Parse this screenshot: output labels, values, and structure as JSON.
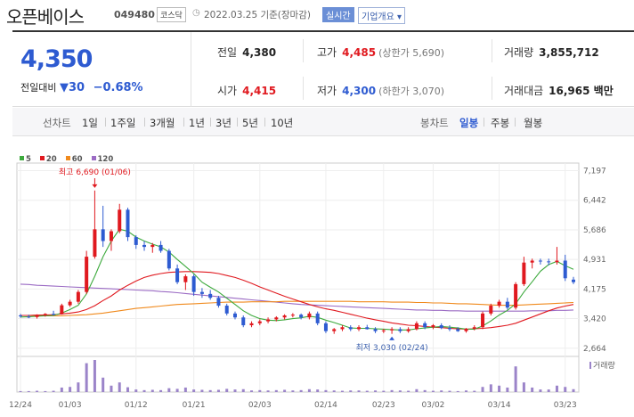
{
  "header": {
    "name": "오픈베이스",
    "code": "049480",
    "market": "코스닥",
    "date_text": "2022.03.25  기준(장마감)",
    "realtime_button": "실시간",
    "company_button": "기업개요 ▾"
  },
  "summary": {
    "price": "4,350",
    "change_label": "전일대비",
    "change_value": "▼30",
    "change_rate": "−0.68%",
    "prev_close_label": "전일",
    "prev_close": "4,380",
    "high_label": "고가",
    "high": "4,485",
    "upper_limit": "(상한가 5,690)",
    "volume_label": "거래량",
    "volume": "3,855,712",
    "open_label": "시가",
    "open": "4,415",
    "low_label": "저가",
    "low": "4,300",
    "lower_limit": "(하한가 3,070)",
    "amount_label": "거래대금",
    "amount": "16,965 백만"
  },
  "tabs": {
    "line_label": "선차트",
    "line_periods": [
      "1일",
      "1주일",
      "3개월",
      "1년",
      "3년",
      "5년",
      "10년"
    ],
    "candle_label": "봉차트",
    "candle_periods": [
      "일봉",
      "주봉",
      "월봉"
    ],
    "selected": "일봉"
  },
  "chart_data": {
    "type": "candlestick",
    "up_color": "#e0191f",
    "down_color": "#2e5bd1",
    "ylim": [
      2500,
      7300
    ],
    "y_ticks": [
      7197,
      6442,
      5686,
      4931,
      4175,
      3420,
      2664
    ],
    "y_tick_labels": [
      "7,197",
      "6,442",
      "5,686",
      "4,931",
      "4,175",
      "3,420",
      "2,664"
    ],
    "x_labels": [
      "12/24",
      "01/03",
      "01/12",
      "01/21",
      "02/03",
      "02/14",
      "02/23",
      "03/02",
      "03/14",
      "03/23"
    ],
    "x_label_index": [
      0,
      6,
      14,
      21,
      29,
      37,
      44,
      50,
      58,
      66
    ],
    "legend": [
      {
        "name": "5",
        "color": "#3daa3d"
      },
      {
        "name": "20",
        "color": "#e0191f"
      },
      {
        "name": "60",
        "color": "#f08a1d"
      },
      {
        "name": "120",
        "color": "#9b6bc4"
      }
    ],
    "volume_label": "거래량",
    "max_annotation": {
      "text": "최고 6,690 (01/06)",
      "index": 9,
      "value": 6690
    },
    "min_annotation": {
      "text": "최저 3,030 (02/24)",
      "index": 45,
      "value": 3030
    },
    "candles": [
      [
        3500,
        3540,
        3440,
        3480
      ],
      [
        3470,
        3520,
        3430,
        3450
      ],
      [
        3460,
        3530,
        3420,
        3500
      ],
      [
        3500,
        3560,
        3470,
        3540
      ],
      [
        3540,
        3620,
        3500,
        3530
      ],
      [
        3530,
        3800,
        3520,
        3760
      ],
      [
        3760,
        3900,
        3720,
        3850
      ],
      [
        3850,
        4150,
        3800,
        4100
      ],
      [
        4100,
        5150,
        4050,
        5000
      ],
      [
        5000,
        6690,
        4950,
        5700
      ],
      [
        5700,
        6300,
        5250,
        5400
      ],
      [
        5400,
        5700,
        5150,
        5650
      ],
      [
        5650,
        6350,
        5600,
        6200
      ],
      [
        6200,
        6250,
        5400,
        5500
      ],
      [
        5500,
        5550,
        5200,
        5300
      ],
      [
        5300,
        5400,
        5150,
        5250
      ],
      [
        5250,
        5350,
        5100,
        5300
      ],
      [
        5300,
        5400,
        5100,
        5150
      ],
      [
        5150,
        5200,
        4650,
        4700
      ],
      [
        4700,
        4800,
        4300,
        4350
      ],
      [
        4350,
        4550,
        4150,
        4500
      ],
      [
        4500,
        4550,
        4000,
        4100
      ],
      [
        4100,
        4200,
        3950,
        4050
      ],
      [
        4050,
        4150,
        3900,
        3950
      ],
      [
        3950,
        4000,
        3700,
        3750
      ],
      [
        3750,
        3800,
        3500,
        3550
      ],
      [
        3550,
        3600,
        3400,
        3450
      ],
      [
        3450,
        3500,
        3200,
        3250
      ],
      [
        3250,
        3350,
        3200,
        3300
      ],
      [
        3300,
        3400,
        3250,
        3350
      ],
      [
        3350,
        3450,
        3300,
        3400
      ],
      [
        3400,
        3480,
        3350,
        3450
      ],
      [
        3450,
        3530,
        3400,
        3500
      ],
      [
        3500,
        3560,
        3450,
        3520
      ],
      [
        3520,
        3550,
        3400,
        3450
      ],
      [
        3450,
        3600,
        3400,
        3550
      ],
      [
        3550,
        3600,
        3250,
        3300
      ],
      [
        3300,
        3350,
        3050,
        3100
      ],
      [
        3100,
        3180,
        3030,
        3150
      ],
      [
        3150,
        3250,
        3100,
        3200
      ],
      [
        3200,
        3250,
        3100,
        3150
      ],
      [
        3150,
        3250,
        3100,
        3200
      ],
      [
        3200,
        3260,
        3140,
        3150
      ],
      [
        3150,
        3200,
        3050,
        3100
      ],
      [
        3100,
        3160,
        3050,
        3120
      ],
      [
        3120,
        3200,
        3030,
        3150
      ],
      [
        3150,
        3200,
        3050,
        3100
      ],
      [
        3100,
        3200,
        3060,
        3150
      ],
      [
        3150,
        3350,
        3120,
        3300
      ],
      [
        3300,
        3350,
        3150,
        3200
      ],
      [
        3200,
        3280,
        3150,
        3250
      ],
      [
        3250,
        3300,
        3150,
        3180
      ],
      [
        3180,
        3250,
        3100,
        3150
      ],
      [
        3150,
        3200,
        3080,
        3100
      ],
      [
        3100,
        3180,
        3060,
        3160
      ],
      [
        3160,
        3250,
        3120,
        3200
      ],
      [
        3200,
        3600,
        3150,
        3550
      ],
      [
        3550,
        3800,
        3500,
        3750
      ],
      [
        3750,
        3900,
        3700,
        3850
      ],
      [
        3850,
        3950,
        3650,
        3700
      ],
      [
        3700,
        4350,
        3650,
        4300
      ],
      [
        4300,
        5000,
        4250,
        4850
      ],
      [
        4850,
        4950,
        4700,
        4900
      ],
      [
        4900,
        4950,
        4800,
        4880
      ],
      [
        4880,
        4950,
        4780,
        4860
      ],
      [
        4860,
        5250,
        4800,
        4900
      ],
      [
        4900,
        5050,
        4380,
        4450
      ],
      [
        4415,
        4485,
        4300,
        4350
      ]
    ],
    "volumes": [
      3,
      3,
      4,
      3,
      4,
      14,
      16,
      30,
      90,
      100,
      45,
      20,
      30,
      15,
      8,
      6,
      7,
      6,
      12,
      10,
      14,
      8,
      7,
      6,
      7,
      10,
      8,
      9,
      5,
      6,
      5,
      6,
      7,
      5,
      6,
      9,
      8,
      6,
      5,
      4,
      5,
      5,
      4,
      5,
      4,
      6,
      5,
      4,
      9,
      6,
      4,
      5,
      4,
      3,
      5,
      4,
      16,
      24,
      20,
      14,
      80,
      30,
      14,
      8,
      8,
      20,
      16,
      9
    ],
    "ma5": [
      3460,
      3470,
      3480,
      3490,
      3500,
      3560,
      3650,
      3760,
      4050,
      4500,
      5000,
      5400,
      5700,
      5650,
      5500,
      5400,
      5320,
      5250,
      5120,
      4930,
      4750,
      4570,
      4350,
      4220,
      4100,
      3940,
      3780,
      3620,
      3500,
      3420,
      3380,
      3370,
      3390,
      3420,
      3440,
      3480,
      3450,
      3380,
      3320,
      3250,
      3180,
      3170,
      3170,
      3160,
      3150,
      3140,
      3130,
      3130,
      3160,
      3180,
      3200,
      3220,
      3200,
      3180,
      3150,
      3150,
      3230,
      3360,
      3510,
      3630,
      3800,
      4100,
      4360,
      4630,
      4800,
      4880,
      4770,
      4680
    ],
    "ma20": [
      3500,
      3500,
      3510,
      3510,
      3520,
      3540,
      3560,
      3590,
      3650,
      3750,
      3880,
      4000,
      4150,
      4270,
      4380,
      4470,
      4530,
      4570,
      4600,
      4610,
      4620,
      4620,
      4610,
      4600,
      4570,
      4520,
      4470,
      4400,
      4320,
      4230,
      4150,
      4070,
      3990,
      3920,
      3850,
      3780,
      3720,
      3670,
      3630,
      3580,
      3530,
      3480,
      3430,
      3390,
      3350,
      3310,
      3280,
      3250,
      3240,
      3220,
      3200,
      3190,
      3170,
      3160,
      3150,
      3160,
      3170,
      3190,
      3220,
      3250,
      3300,
      3380,
      3460,
      3540,
      3620,
      3690,
      3740,
      3780
    ],
    "ma60": [
      3500,
      3500,
      3490,
      3490,
      3490,
      3490,
      3500,
      3510,
      3520,
      3540,
      3560,
      3590,
      3620,
      3650,
      3680,
      3700,
      3720,
      3740,
      3760,
      3780,
      3790,
      3800,
      3810,
      3820,
      3830,
      3840,
      3840,
      3840,
      3850,
      3850,
      3850,
      3850,
      3860,
      3860,
      3860,
      3860,
      3860,
      3860,
      3860,
      3860,
      3860,
      3850,
      3850,
      3850,
      3850,
      3840,
      3840,
      3840,
      3830,
      3830,
      3820,
      3820,
      3810,
      3800,
      3800,
      3790,
      3780,
      3770,
      3760,
      3760,
      3760,
      3770,
      3780,
      3790,
      3800,
      3810,
      3820,
      3830
    ],
    "ma120": [
      4300,
      4290,
      4270,
      4260,
      4250,
      4240,
      4230,
      4220,
      4210,
      4200,
      4190,
      4180,
      4170,
      4160,
      4150,
      4140,
      4130,
      4110,
      4100,
      4080,
      4060,
      4040,
      4020,
      4000,
      3980,
      3960,
      3940,
      3920,
      3900,
      3880,
      3860,
      3840,
      3820,
      3800,
      3780,
      3770,
      3760,
      3750,
      3740,
      3730,
      3720,
      3710,
      3700,
      3690,
      3680,
      3670,
      3660,
      3650,
      3640,
      3640,
      3630,
      3630,
      3620,
      3620,
      3610,
      3610,
      3610,
      3610,
      3610,
      3610,
      3610,
      3610,
      3620,
      3620,
      3620,
      3630,
      3630,
      3640
    ]
  }
}
